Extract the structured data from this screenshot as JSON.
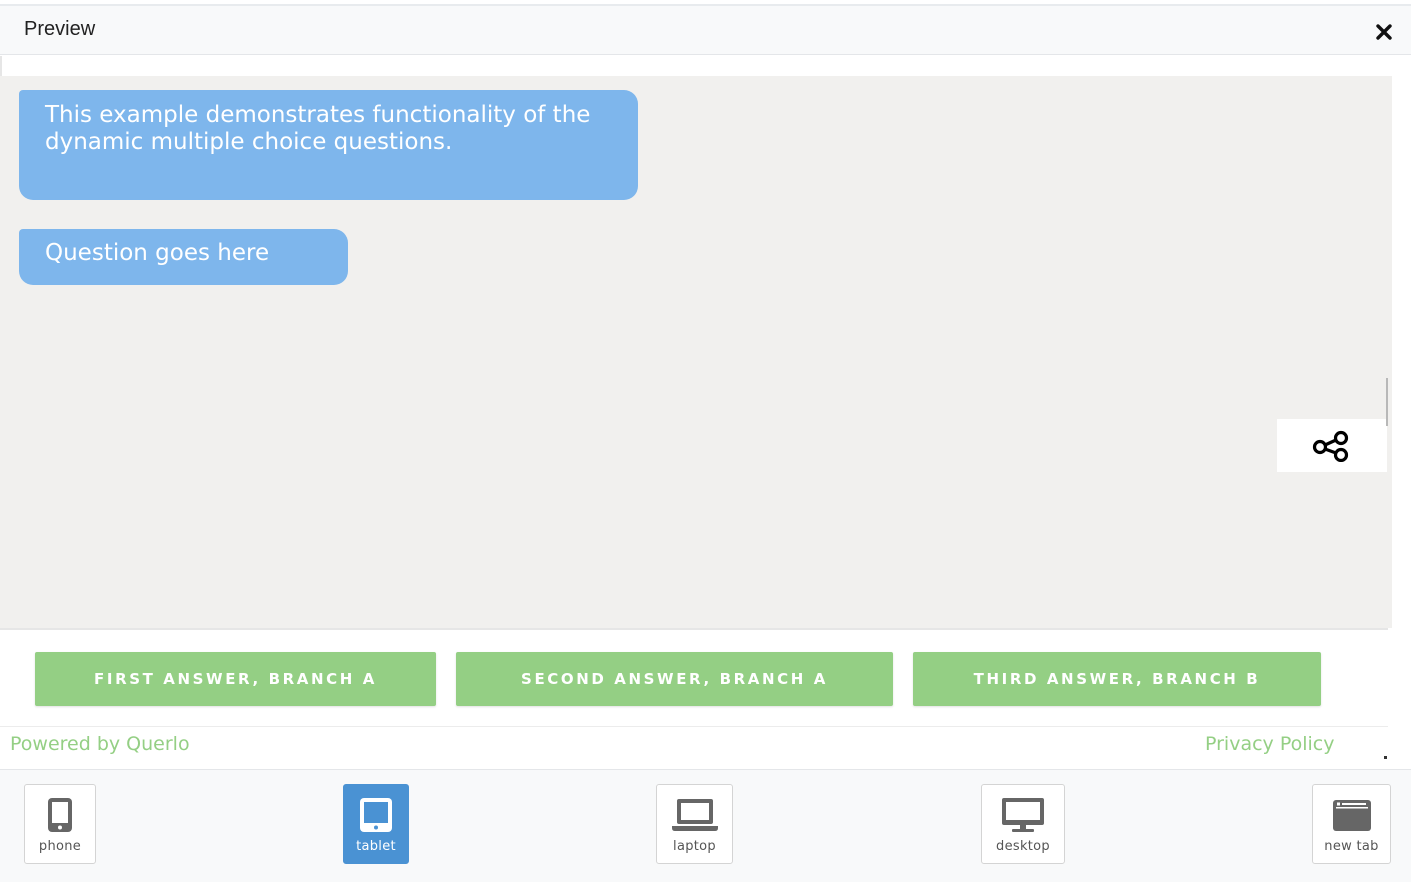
{
  "modal": {
    "title": "Preview"
  },
  "chat": {
    "messages": [
      "This example demonstrates functionality of the dynamic multiple choice questions.",
      "Question goes here"
    ]
  },
  "answers": [
    "FIRST ANSWER, BRANCH A",
    "SECOND ANSWER, BRANCH A",
    "THIRD ANSWER, BRANCH B"
  ],
  "footer": {
    "powered_by": "Powered by Querlo",
    "privacy": "Privacy Policy"
  },
  "devices": [
    {
      "label": "phone",
      "icon": "phone-icon",
      "active": false
    },
    {
      "label": "tablet",
      "icon": "tablet-icon",
      "active": true
    },
    {
      "label": "laptop",
      "icon": "laptop-icon",
      "active": false
    },
    {
      "label": "desktop",
      "icon": "desktop-icon",
      "active": false
    },
    {
      "label": "new tab",
      "icon": "new-tab-icon",
      "active": false
    }
  ],
  "colors": {
    "bubble": "#7eb6ec",
    "answer": "#94cf84",
    "link": "#94cf84",
    "active_device": "#4a92d3",
    "chat_background": "#f1f0ee"
  }
}
